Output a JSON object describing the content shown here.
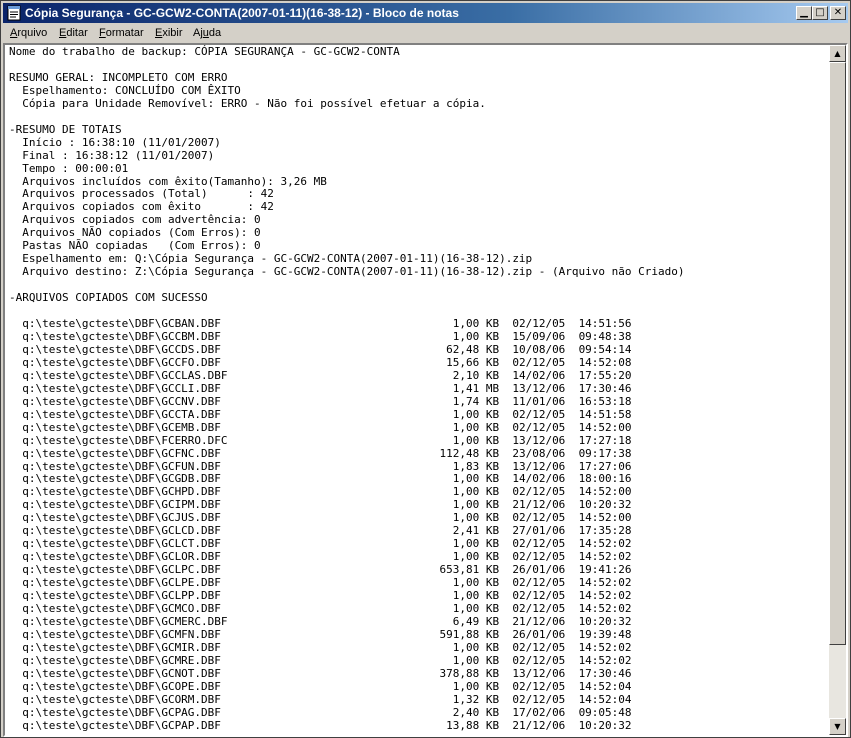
{
  "window": {
    "title": "Cópia Segurança - GC-GCW2-CONTA(2007-01-11)(16-38-12) - Bloco de notas",
    "icon": "notepad-icon"
  },
  "menu": [
    {
      "label": "Arquivo",
      "accel": "A",
      "rest": "rquivo"
    },
    {
      "label": "Editar",
      "accel": "E",
      "rest": "ditar"
    },
    {
      "label": "Formatar",
      "accel": "F",
      "rest": "ormatar"
    },
    {
      "label": "Exibir",
      "accel": "E",
      "rest": "xibir"
    },
    {
      "label": "Ajuda",
      "accel": "u",
      "pre": "Aj",
      "rest": "da"
    }
  ],
  "document": {
    "lines": [
      "Nome do trabalho de backup: CÓPIA SEGURANÇA - GC-GCW2-CONTA",
      "",
      "RESUMO GERAL: INCOMPLETO COM ERRO",
      "  Espelhamento: CONCLUÍDO COM ÊXITO",
      "  Cópia para Unidade Removível: ERRO - Não foi possível efetuar a cópia.",
      "",
      "-RESUMO DE TOTAIS",
      "  Início : 16:38:10 (11/01/2007)",
      "  Final : 16:38:12 (11/01/2007)",
      "  Tempo : 00:00:01",
      "  Arquivos incluídos com êxito(Tamanho): 3,26 MB",
      "  Arquivos processados (Total)      : 42",
      "  Arquivos copiados com êxito       : 42",
      "  Arquivos copiados com advertência: 0",
      "  Arquivos NÃO copiados (Com Erros): 0",
      "  Pastas NÃO copiadas   (Com Erros): 0",
      "  Espelhamento em: Q:\\Cópia Segurança - GC-GCW2-CONTA(2007-01-11)(16-38-12).zip",
      "  Arquivo destino: Z:\\Cópia Segurança - GC-GCW2-CONTA(2007-01-11)(16-38-12).zip - (Arquivo não Criado)",
      "",
      "-ARQUIVOS COPIADOS COM SUCESSO",
      ""
    ],
    "files": [
      {
        "path": "q:\\teste\\gcteste\\DBF\\GCBAN.DBF",
        "size": "1,00 KB",
        "date": "02/12/05",
        "time": "14:51:56"
      },
      {
        "path": "q:\\teste\\gcteste\\DBF\\GCCBM.DBF",
        "size": "1,00 KB",
        "date": "15/09/06",
        "time": "09:48:38"
      },
      {
        "path": "q:\\teste\\gcteste\\DBF\\GCCDS.DBF",
        "size": "62,48 KB",
        "date": "10/08/06",
        "time": "09:54:14"
      },
      {
        "path": "q:\\teste\\gcteste\\DBF\\GCCFO.DBF",
        "size": "15,66 KB",
        "date": "02/12/05",
        "time": "14:52:08"
      },
      {
        "path": "q:\\teste\\gcteste\\DBF\\GCCLAS.DBF",
        "size": "2,10 KB",
        "date": "14/02/06",
        "time": "17:55:20"
      },
      {
        "path": "q:\\teste\\gcteste\\DBF\\GCCLI.DBF",
        "size": "1,41 MB",
        "date": "13/12/06",
        "time": "17:30:46"
      },
      {
        "path": "q:\\teste\\gcteste\\DBF\\GCCNV.DBF",
        "size": "1,74 KB",
        "date": "11/01/06",
        "time": "16:53:18"
      },
      {
        "path": "q:\\teste\\gcteste\\DBF\\GCCTA.DBF",
        "size": "1,00 KB",
        "date": "02/12/05",
        "time": "14:51:58"
      },
      {
        "path": "q:\\teste\\gcteste\\DBF\\GCEMB.DBF",
        "size": "1,00 KB",
        "date": "02/12/05",
        "time": "14:52:00"
      },
      {
        "path": "q:\\teste\\gcteste\\DBF\\FCERRO.DFC",
        "size": "1,00 KB",
        "date": "13/12/06",
        "time": "17:27:18"
      },
      {
        "path": "q:\\teste\\gcteste\\DBF\\GCFNC.DBF",
        "size": "112,48 KB",
        "date": "23/08/06",
        "time": "09:17:38"
      },
      {
        "path": "q:\\teste\\gcteste\\DBF\\GCFUN.DBF",
        "size": "1,83 KB",
        "date": "13/12/06",
        "time": "17:27:06"
      },
      {
        "path": "q:\\teste\\gcteste\\DBF\\GCGDB.DBF",
        "size": "1,00 KB",
        "date": "14/02/06",
        "time": "18:00:16"
      },
      {
        "path": "q:\\teste\\gcteste\\DBF\\GCHPD.DBF",
        "size": "1,00 KB",
        "date": "02/12/05",
        "time": "14:52:00"
      },
      {
        "path": "q:\\teste\\gcteste\\DBF\\GCIPM.DBF",
        "size": "1,00 KB",
        "date": "21/12/06",
        "time": "10:20:32"
      },
      {
        "path": "q:\\teste\\gcteste\\DBF\\GCJUS.DBF",
        "size": "1,00 KB",
        "date": "02/12/05",
        "time": "14:52:00"
      },
      {
        "path": "q:\\teste\\gcteste\\DBF\\GCLCD.DBF",
        "size": "2,41 KB",
        "date": "27/01/06",
        "time": "17:35:28"
      },
      {
        "path": "q:\\teste\\gcteste\\DBF\\GCLCT.DBF",
        "size": "1,00 KB",
        "date": "02/12/05",
        "time": "14:52:02"
      },
      {
        "path": "q:\\teste\\gcteste\\DBF\\GCLOR.DBF",
        "size": "1,00 KB",
        "date": "02/12/05",
        "time": "14:52:02"
      },
      {
        "path": "q:\\teste\\gcteste\\DBF\\GCLPC.DBF",
        "size": "653,81 KB",
        "date": "26/01/06",
        "time": "19:41:26"
      },
      {
        "path": "q:\\teste\\gcteste\\DBF\\GCLPE.DBF",
        "size": "1,00 KB",
        "date": "02/12/05",
        "time": "14:52:02"
      },
      {
        "path": "q:\\teste\\gcteste\\DBF\\GCLPP.DBF",
        "size": "1,00 KB",
        "date": "02/12/05",
        "time": "14:52:02"
      },
      {
        "path": "q:\\teste\\gcteste\\DBF\\GCMCO.DBF",
        "size": "1,00 KB",
        "date": "02/12/05",
        "time": "14:52:02"
      },
      {
        "path": "q:\\teste\\gcteste\\DBF\\GCMERC.DBF",
        "size": "6,49 KB",
        "date": "21/12/06",
        "time": "10:20:32"
      },
      {
        "path": "q:\\teste\\gcteste\\DBF\\GCMFN.DBF",
        "size": "591,88 KB",
        "date": "26/01/06",
        "time": "19:39:48"
      },
      {
        "path": "q:\\teste\\gcteste\\DBF\\GCMIR.DBF",
        "size": "1,00 KB",
        "date": "02/12/05",
        "time": "14:52:02"
      },
      {
        "path": "q:\\teste\\gcteste\\DBF\\GCMRE.DBF",
        "size": "1,00 KB",
        "date": "02/12/05",
        "time": "14:52:02"
      },
      {
        "path": "q:\\teste\\gcteste\\DBF\\GCNOT.DBF",
        "size": "378,88 KB",
        "date": "13/12/06",
        "time": "17:30:46"
      },
      {
        "path": "q:\\teste\\gcteste\\DBF\\GCOPE.DBF",
        "size": "1,00 KB",
        "date": "02/12/05",
        "time": "14:52:04"
      },
      {
        "path": "q:\\teste\\gcteste\\DBF\\GCORM.DBF",
        "size": "1,32 KB",
        "date": "02/12/05",
        "time": "14:52:04"
      },
      {
        "path": "q:\\teste\\gcteste\\DBF\\GCPAG.DBF",
        "size": "2,40 KB",
        "date": "17/02/06",
        "time": "09:05:48"
      },
      {
        "path": "q:\\teste\\gcteste\\DBF\\GCPAP.DBF",
        "size": "13,88 KB",
        "date": "21/12/06",
        "time": "10:20:32"
      }
    ]
  }
}
